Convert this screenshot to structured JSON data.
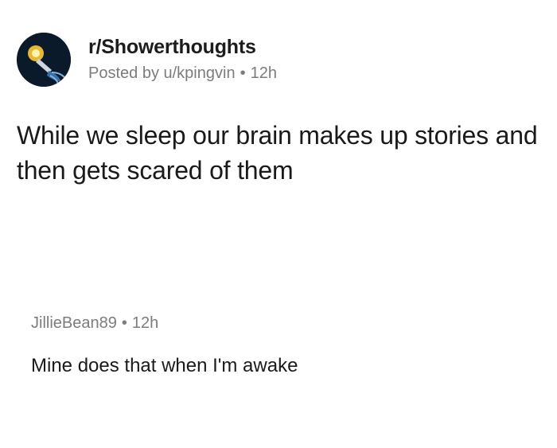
{
  "post": {
    "subreddit": "r/Showerthoughts",
    "posted_by": "Posted by u/kpingvin",
    "separator": "•",
    "age": "12h",
    "title": "While we sleep our brain makes up stories and then gets scared of them",
    "avatar_icon": "lightbulb-brain-icon"
  },
  "comment": {
    "author": "JillieBean89",
    "separator": "•",
    "age": "12h",
    "body": "Mine does that when I'm awake"
  },
  "colors": {
    "text": "#1a1a1b",
    "meta": "#7c7c7c",
    "avatar_bg": "#0b1a2b",
    "bulb": "#f2c230"
  }
}
